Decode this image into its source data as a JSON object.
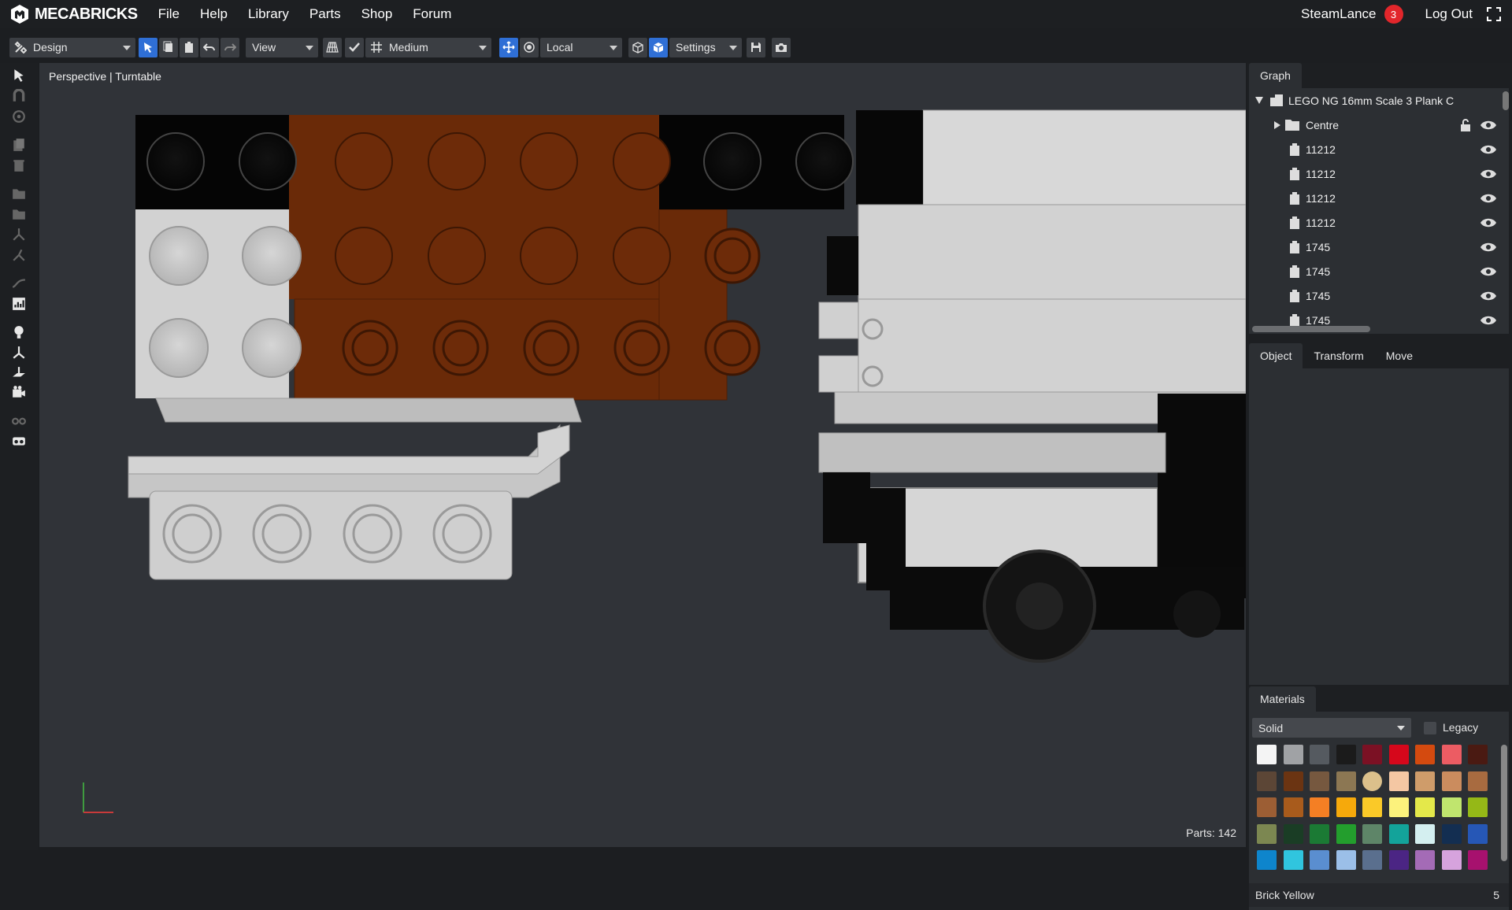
{
  "brand": {
    "name": "MECABRICKS"
  },
  "menu": [
    "File",
    "Help",
    "Library",
    "Parts",
    "Shop",
    "Forum"
  ],
  "user": {
    "name": "SteamLance",
    "notifications": "3",
    "logout": "Log Out"
  },
  "toolbar": {
    "mode": "Design",
    "view": "View",
    "quality": "Medium",
    "space": "Local",
    "settings": "Settings"
  },
  "viewport": {
    "camera_label": "Perspective | Turntable",
    "parts_label": "Parts: 142"
  },
  "graph": {
    "tab": "Graph",
    "root": "LEGO NG 16mm Scale 3 Plank C",
    "items": [
      {
        "label": "Centre",
        "type": "folder"
      },
      {
        "label": "11212",
        "type": "part"
      },
      {
        "label": "11212",
        "type": "part"
      },
      {
        "label": "11212",
        "type": "part"
      },
      {
        "label": "11212",
        "type": "part"
      },
      {
        "label": "1745",
        "type": "part"
      },
      {
        "label": "1745",
        "type": "part"
      },
      {
        "label": "1745",
        "type": "part"
      },
      {
        "label": "1745",
        "type": "part"
      }
    ]
  },
  "object_tabs": [
    "Object",
    "Transform",
    "Move"
  ],
  "materials": {
    "tab": "Materials",
    "type": "Solid",
    "legacy_label": "Legacy",
    "selected_name": "Brick Yellow",
    "selected_num": "5",
    "swatches": [
      "#f4f4f4",
      "#a0a2a5",
      "#555a60",
      "#1b1b1b",
      "#7b1124",
      "#d6071b",
      "#d44a0f",
      "#ec5c63",
      "#4a1a12",
      "#5c4636",
      "#6b3412",
      "#76583f",
      "#8c7753",
      "#dbc08b",
      "#f4c7a3",
      "#cf9c6a",
      "#cb8c5e",
      "#a86b40",
      "#9c5e34",
      "#a85b1c",
      "#f47f24",
      "#f6a90b",
      "#fac928",
      "#fcf27c",
      "#e4e84a",
      "#c0e56e",
      "#95b817",
      "#7c8751",
      "#1a3d25",
      "#1b7a34",
      "#239e2d",
      "#5e8568",
      "#13a39a",
      "#d4eff0",
      "#132e51",
      "#2657b6",
      "#0e85cc",
      "#30c5de",
      "#5a8ed0",
      "#9bbfe8",
      "#5a6f8e",
      "#4b2584",
      "#a46bb6",
      "#d6a3dd",
      "#a7116e"
    ]
  }
}
